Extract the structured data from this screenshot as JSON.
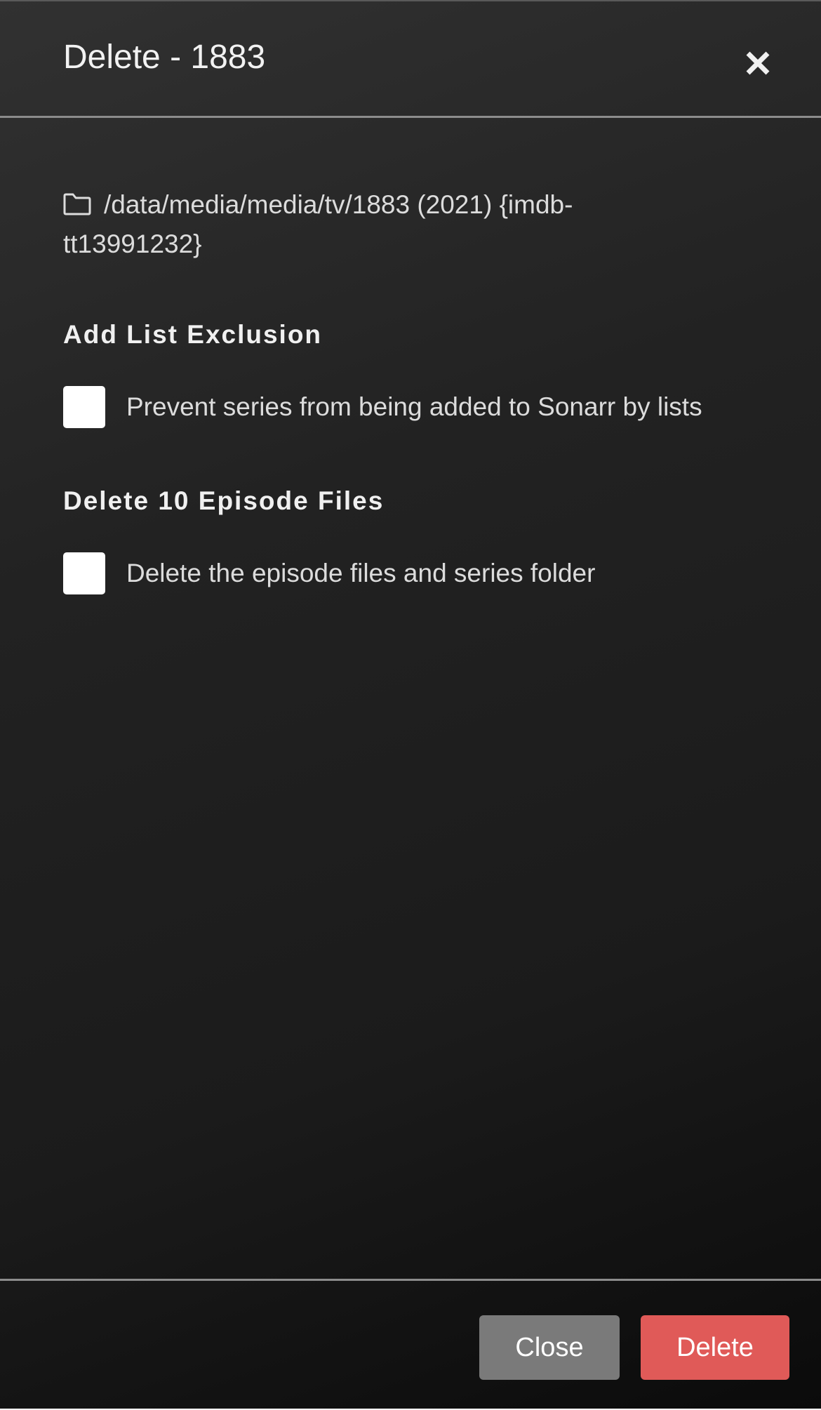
{
  "modal": {
    "title": "Delete - 1883",
    "close_icon": "close-icon"
  },
  "folder": {
    "icon": "folder-icon",
    "path_line1": "/data/media/media/tv/1883 (2021) {imdb-",
    "path_line2": "tt13991232}"
  },
  "list_exclusion": {
    "heading": "Add List Exclusion",
    "checkbox_label": "Prevent series from being added to Sonarr by lists",
    "checked": false
  },
  "delete_files": {
    "heading": "Delete 10 Episode Files",
    "checkbox_label": "Delete the episode files and series folder",
    "checked": false
  },
  "footer": {
    "close_label": "Close",
    "delete_label": "Delete"
  },
  "colors": {
    "delete_button": "#e05a58",
    "close_button": "#7a7a7a",
    "background": "#1e1e1e"
  }
}
